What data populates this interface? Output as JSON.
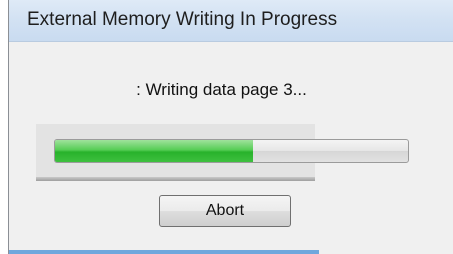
{
  "window": {
    "title": "External Memory Writing In Progress"
  },
  "status": {
    "message": ": Writing data page 3..."
  },
  "progress": {
    "fraction": 0.56,
    "fill_color": "#3ec03f"
  },
  "actions": {
    "abort_label": "Abort"
  }
}
